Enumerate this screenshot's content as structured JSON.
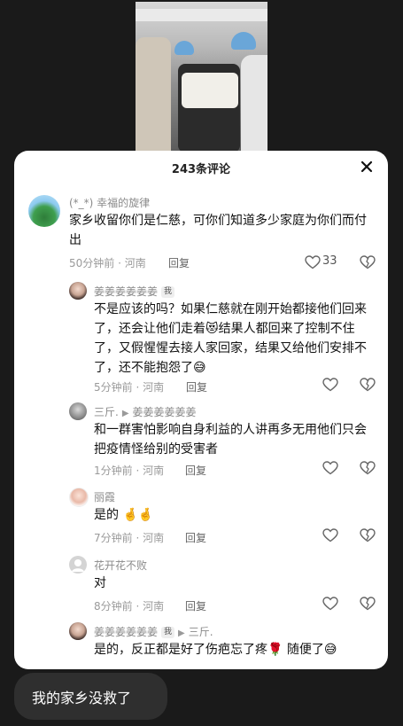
{
  "header": {
    "title": "243条评论"
  },
  "comments": [
    {
      "name": "(*_*) 幸福的旋律",
      "text": "家乡收留你们是仁慈，可你们知道多少家庭为你们而付出",
      "time": "50分钟前 · 河南",
      "reply": "回复",
      "likes": "33"
    },
    {
      "name": "姜姜姜姜姜姜",
      "badge": "我",
      "text": "不是应该的吗？如果仁慈就在刚开始都接他们回来了，还会让他们走着😻结果人都回来了控制不住了，又假惺惺去接人家回家，结果又给他们安排不了，还不能抱怨了😅",
      "time": "5分钟前 · 河南",
      "reply": "回复"
    },
    {
      "name": "三斤.",
      "reply_to": "姜姜姜姜姜姜",
      "text": "和一群害怕影响自身利益的人讲再多无用他们只会把疫情怪给别的受害者",
      "time": "1分钟前 · 河南",
      "reply": "回复"
    },
    {
      "name": "丽霞",
      "text": "是的 🤞🤞",
      "time": "7分钟前 · 河南",
      "reply": "回复"
    },
    {
      "name": "花开花不败",
      "text": "对",
      "time": "8分钟前 · 河南",
      "reply": "回复"
    },
    {
      "name": "姜姜姜姜姜姜",
      "badge": "我",
      "reply_to": "三斤.",
      "text": "是的，反正都是好了伤疤忘了疼🌹 随便了😅"
    }
  ],
  "message": {
    "text": "我的家乡没救了"
  }
}
